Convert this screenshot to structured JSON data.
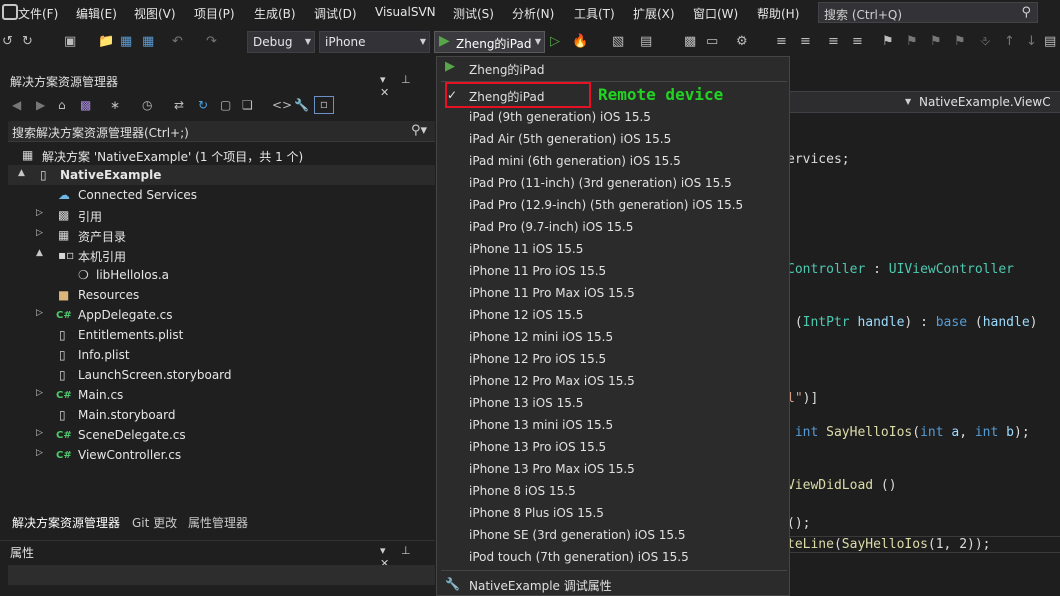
{
  "menubar": {
    "items": [
      "文件(F)",
      "编辑(E)",
      "视图(V)",
      "项目(P)",
      "生成(B)",
      "调试(D)",
      "VisualSVN",
      "测试(S)",
      "分析(N)",
      "工具(T)",
      "扩展(X)",
      "窗口(W)",
      "帮助(H)"
    ],
    "search_text": "搜索 (Ctrl+Q)"
  },
  "toolbar": {
    "config": "Debug",
    "platform": "iPhone",
    "run_target": "Zheng的iPad"
  },
  "solution_explorer": {
    "title": "解决方案资源管理器",
    "search_text": "搜索解决方案资源管理器(Ctrl+;)",
    "tree": [
      {
        "label": "解决方案 'NativeExample' (1 个项目，共 1 个)",
        "icon": "solution-icon",
        "expander": ""
      },
      {
        "label": "NativeExample",
        "icon": "ios-project-icon",
        "expander": "▲"
      },
      {
        "label": "Connected Services",
        "icon": "connected-services-icon",
        "expander": ""
      },
      {
        "label": "引用",
        "icon": "references-icon",
        "expander": "▷"
      },
      {
        "label": "资产目录",
        "icon": "asset-catalog-icon",
        "expander": "▷"
      },
      {
        "label": "本机引用",
        "icon": "native-references-icon",
        "expander": "▲"
      },
      {
        "label": "libHelloIos.a",
        "icon": "library-icon",
        "expander": ""
      },
      {
        "label": "Resources",
        "icon": "folder-icon",
        "expander": ""
      },
      {
        "label": "AppDelegate.cs",
        "icon": "csharp-file-icon",
        "expander": "▷"
      },
      {
        "label": "Entitlements.plist",
        "icon": "file-icon",
        "expander": ""
      },
      {
        "label": "Info.plist",
        "icon": "file-icon",
        "expander": ""
      },
      {
        "label": "LaunchScreen.storyboard",
        "icon": "file-icon",
        "expander": ""
      },
      {
        "label": "Main.cs",
        "icon": "csharp-file-icon",
        "expander": "▷"
      },
      {
        "label": "Main.storyboard",
        "icon": "file-icon",
        "expander": ""
      },
      {
        "label": "SceneDelegate.cs",
        "icon": "csharp-file-icon",
        "expander": "▷"
      },
      {
        "label": "ViewController.cs",
        "icon": "csharp-file-icon",
        "expander": "▷"
      }
    ],
    "bottom_tabs": [
      "解决方案资源管理器",
      "Git 更改",
      "属性管理器"
    ]
  },
  "properties": {
    "title": "属性"
  },
  "dropdown": {
    "items": [
      {
        "label": "Zheng的iPad",
        "kind": "play"
      },
      {
        "label": "Zheng的iPad",
        "kind": "checked"
      },
      {
        "label": "iPad (9th generation) iOS 15.5"
      },
      {
        "label": "iPad Air (5th generation) iOS 15.5"
      },
      {
        "label": "iPad mini (6th generation) iOS 15.5"
      },
      {
        "label": "iPad Pro (11-inch) (3rd generation) iOS 15.5"
      },
      {
        "label": "iPad Pro (12.9-inch) (5th generation) iOS 15.5"
      },
      {
        "label": "iPad Pro (9.7-inch) iOS 15.5"
      },
      {
        "label": "iPhone 11 iOS 15.5"
      },
      {
        "label": "iPhone 11 Pro iOS 15.5"
      },
      {
        "label": "iPhone 11 Pro Max iOS 15.5"
      },
      {
        "label": "iPhone 12 iOS 15.5"
      },
      {
        "label": "iPhone 12 mini iOS 15.5"
      },
      {
        "label": "iPhone 12 Pro iOS 15.5"
      },
      {
        "label": "iPhone 12 Pro Max iOS 15.5"
      },
      {
        "label": "iPhone 13 iOS 15.5"
      },
      {
        "label": "iPhone 13 mini iOS 15.5"
      },
      {
        "label": "iPhone 13 Pro iOS 15.5"
      },
      {
        "label": "iPhone 13 Pro Max iOS 15.5"
      },
      {
        "label": "iPhone 8 iOS 15.5"
      },
      {
        "label": "iPhone 8 Plus iOS 15.5"
      },
      {
        "label": "iPhone SE (3rd generation) iOS 15.5"
      },
      {
        "label": "iPod touch (7th generation) iOS 15.5"
      },
      {
        "label": "NativeExample 调试属性",
        "kind": "wrench"
      }
    ],
    "annotation": "Remote device"
  },
  "editor": {
    "nav_text": "NativeExample.ViewC",
    "lines": {
      "l1": "ervices;",
      "l2_a": "Controller",
      "l2_b": " : ",
      "l2_c": "UIViewController",
      "l3_a": " (",
      "l3_b": "IntPtr",
      "l3_c": " ",
      "l3_d": "handle",
      "l3_e": ") : ",
      "l3_f": "base",
      "l3_g": " (",
      "l3_h": "handle",
      "l3_i": ")",
      "l4_a": "l\"",
      "l4_b": ")]",
      "l5_a": " ",
      "l5_b": "int",
      "l5_c": " ",
      "l5_d": "SayHelloIos",
      "l5_e": "(",
      "l5_f": "int",
      "l5_g": " ",
      "l5_h": "a",
      "l5_i": ", ",
      "l5_j": "int",
      "l5_k": " ",
      "l5_l": "b",
      "l5_m": ");",
      "l6_a": "ViewDidLoad",
      "l6_b": " ()",
      "l7": "();",
      "l8_a": "teLine",
      "l8_b": "(",
      "l8_c": "SayHelloIos",
      "l8_d": "(1, 2));"
    }
  },
  "colors": {
    "accent_red": "#e81123",
    "annotation_green": "#22d322",
    "play_green": "#57a64a"
  }
}
